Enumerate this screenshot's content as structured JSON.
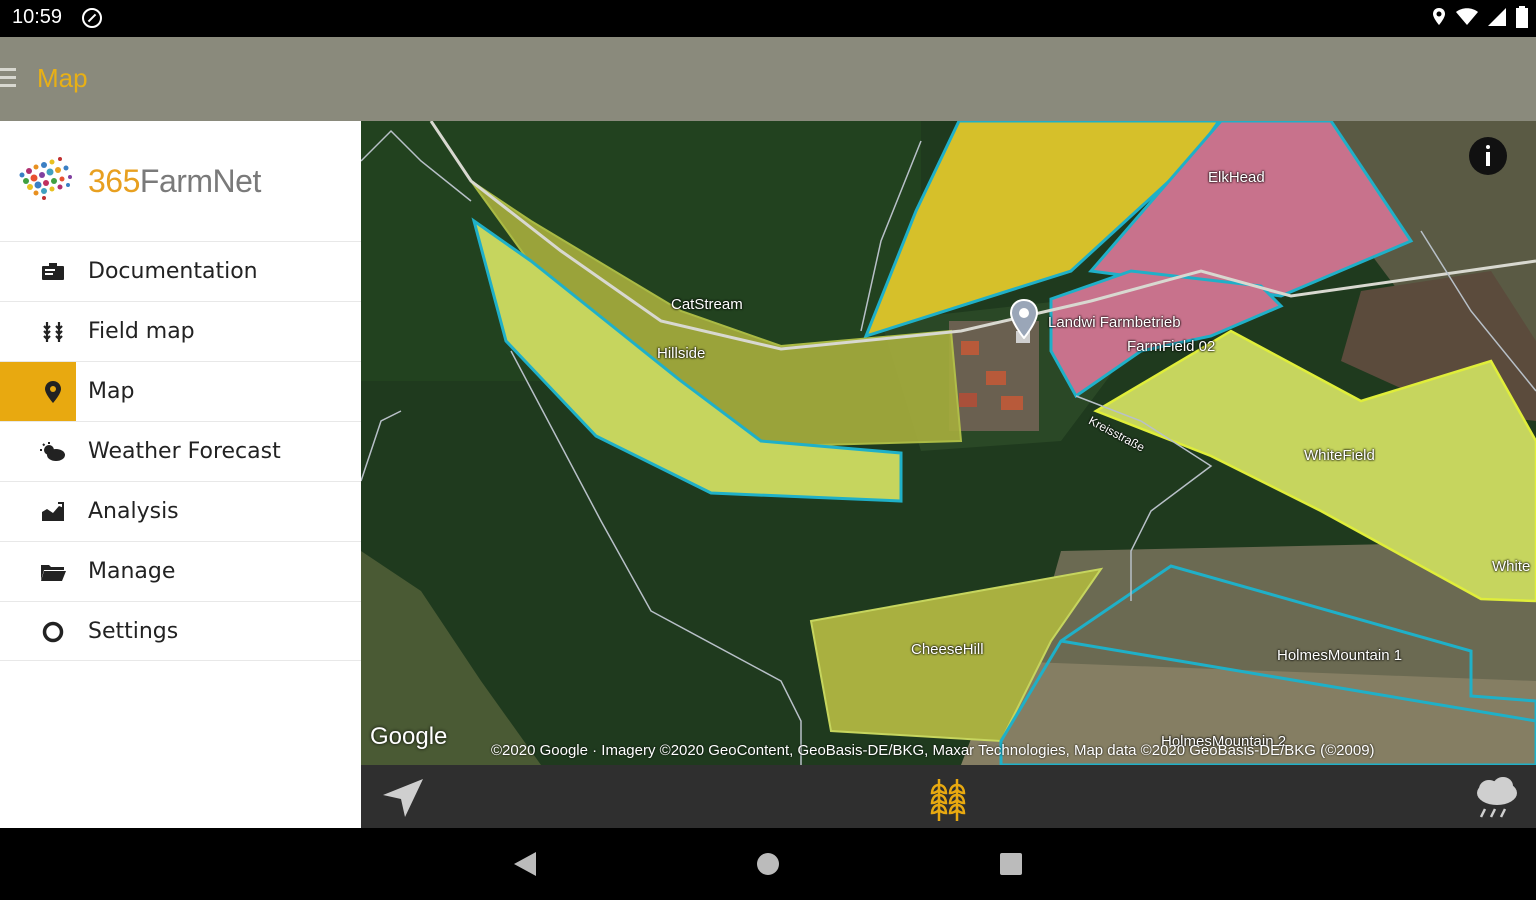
{
  "status_bar": {
    "time": "10:59"
  },
  "app_bar": {
    "title": "Map",
    "menu_icon": "hamburger-menu-icon"
  },
  "drawer": {
    "logo": {
      "number": "365",
      "name": "FarmNet"
    },
    "items": [
      {
        "label": "Documentation",
        "icon": "documentation-icon",
        "active": false
      },
      {
        "label": "Field map",
        "icon": "field-map-icon",
        "active": false
      },
      {
        "label": "Map",
        "icon": "map-pin-icon",
        "active": true
      },
      {
        "label": "Weather Forecast",
        "icon": "weather-icon",
        "active": false
      },
      {
        "label": "Analysis",
        "icon": "analysis-icon",
        "active": false
      },
      {
        "label": "Manage",
        "icon": "folder-icon",
        "active": false
      },
      {
        "label": "Settings",
        "icon": "settings-icon",
        "active": false
      }
    ]
  },
  "map": {
    "field_labels": {
      "elk_head": "ElkHead",
      "cat_stream": "CatStream",
      "hillside": "Hillside",
      "landwirt": "Landwi Farmbetrieb",
      "farm_field": "FarmField 02",
      "white_field": "WhiteField",
      "white_edge": "White",
      "cheese_hill": "CheeseHill",
      "holmes_mountain_1": "HolmesMountain 1",
      "holmes_mountain_2": "HolmesMountain 2",
      "road_label": "Kreisstraße"
    },
    "google_logo": "Google",
    "attribution": "©2020 Google · Imagery ©2020 GeoContent, GeoBasis-DE/BKG, Maxar Technologies, Map data ©2020 GeoBasis-DE/BKG (©2009)"
  },
  "map_toolbar": {
    "left_icon": "navigation-arrow-icon",
    "center_icon": "crop-wheat-icon",
    "right_icon": "weather-cloud-icon"
  },
  "colors": {
    "accent": "#e8a910",
    "app_bar": "#8a8a7c",
    "field_yellow": "#d6c02a",
    "field_pink": "#c8728c",
    "field_lime": "#c6d55e",
    "field_olive": "#a5ac3d",
    "field_border_cyan": "#1fb0c8"
  }
}
